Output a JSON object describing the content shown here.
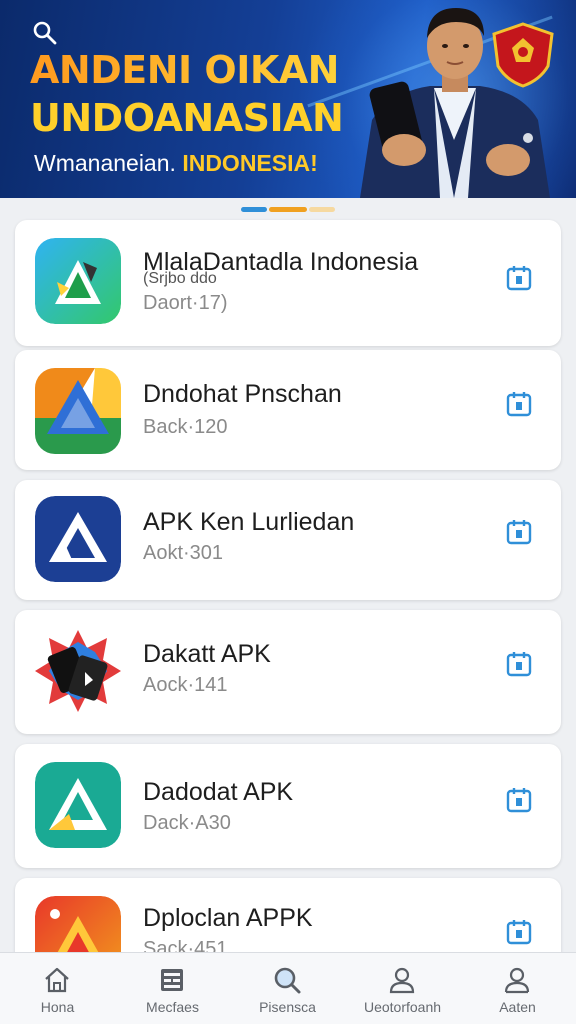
{
  "banner": {
    "headline_line1": "ANDENI OIKAN",
    "headline_line2": "UNDOANASIAN",
    "subline_prefix": "Wmananeian.",
    "subline_accent": "INDONESIA!"
  },
  "pager": {
    "colors": [
      "#2f8fd8",
      "#f0a020",
      "#f6d9a0"
    ]
  },
  "apps": [
    {
      "title": "MlalaDantadla Indonesia",
      "subtitle_extra": "(Srjbo ddo",
      "subtitle": "Daort·17)"
    },
    {
      "title": "Dndohat Pnschan",
      "subtitle": "Back·120"
    },
    {
      "title": "APK Ken Lurliedan",
      "subtitle": "Aokt·301"
    },
    {
      "title": "Dakatt APK",
      "subtitle": "Aock·141"
    },
    {
      "title": "Dadodat APK",
      "subtitle": "Dack·A30"
    },
    {
      "title": "Dploclan APPK",
      "subtitle": "Sack·451"
    }
  ],
  "bottom_nav": [
    {
      "label": "Hona",
      "icon": "home-icon"
    },
    {
      "label": "Mecfaes",
      "icon": "grid-icon"
    },
    {
      "label": "Pisensca",
      "icon": "search-icon"
    },
    {
      "label": "Ueotorfoanh",
      "icon": "user-icon"
    },
    {
      "label": "Aaten",
      "icon": "account-icon"
    }
  ],
  "colors": {
    "accent": "#2f8fd8",
    "banner_bg": "#143f96",
    "headline": "#ffd02b"
  }
}
